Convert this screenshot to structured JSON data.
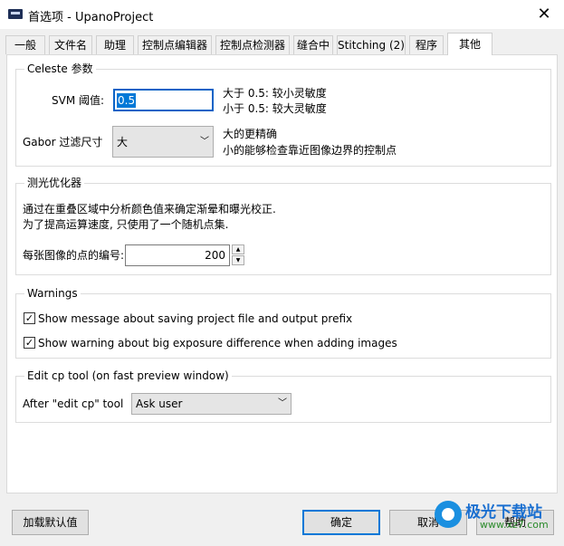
{
  "window": {
    "title": "首选项 - UpanoProject",
    "close_glyph": "✕"
  },
  "tabs": [
    {
      "label": "一般"
    },
    {
      "label": "文件名"
    },
    {
      "label": "助理"
    },
    {
      "label": "控制点编辑器"
    },
    {
      "label": "控制点检测器"
    },
    {
      "label": "缝合中"
    },
    {
      "label": "Stitching (2)"
    },
    {
      "label": "程序"
    },
    {
      "label": "其他"
    }
  ],
  "active_tab": "其他",
  "celeste": {
    "title": "Celeste 参数",
    "svm_label": "SVM 阈值:",
    "svm_value": "0.5",
    "svm_hint_1": "大于 0.5: 较小灵敏度",
    "svm_hint_2": "小于 0.5: 较大灵敏度",
    "gabor_label": "Gabor 过滤尺寸",
    "gabor_value": "大",
    "gabor_hint_1": "大的更精确",
    "gabor_hint_2": "小的能够检查靠近图像边界的控制点"
  },
  "photometric": {
    "title": "测光优化器",
    "desc_1": "通过在重叠区域中分析颜色值来确定渐晕和曝光校正.",
    "desc_2": "为了提高运算速度, 只使用了一个随机点集.",
    "points_label": "每张图像的点的编号:",
    "points_value": "200"
  },
  "warnings": {
    "title": "Warnings",
    "items": [
      {
        "label": "Show message about saving project file and output prefix",
        "checked": true
      },
      {
        "label": "Show warning about big exposure difference when adding images",
        "checked": true
      }
    ]
  },
  "editcp": {
    "title": "Edit cp tool (on fast preview window)",
    "after_label": "After \"edit cp\" tool",
    "after_value": "Ask user"
  },
  "buttons": {
    "load_defaults": "加载默认值",
    "ok": "确定",
    "cancel": "取消",
    "help": "帮助"
  },
  "watermark": {
    "text": "极光下载站",
    "url": "www.xz7.com"
  }
}
